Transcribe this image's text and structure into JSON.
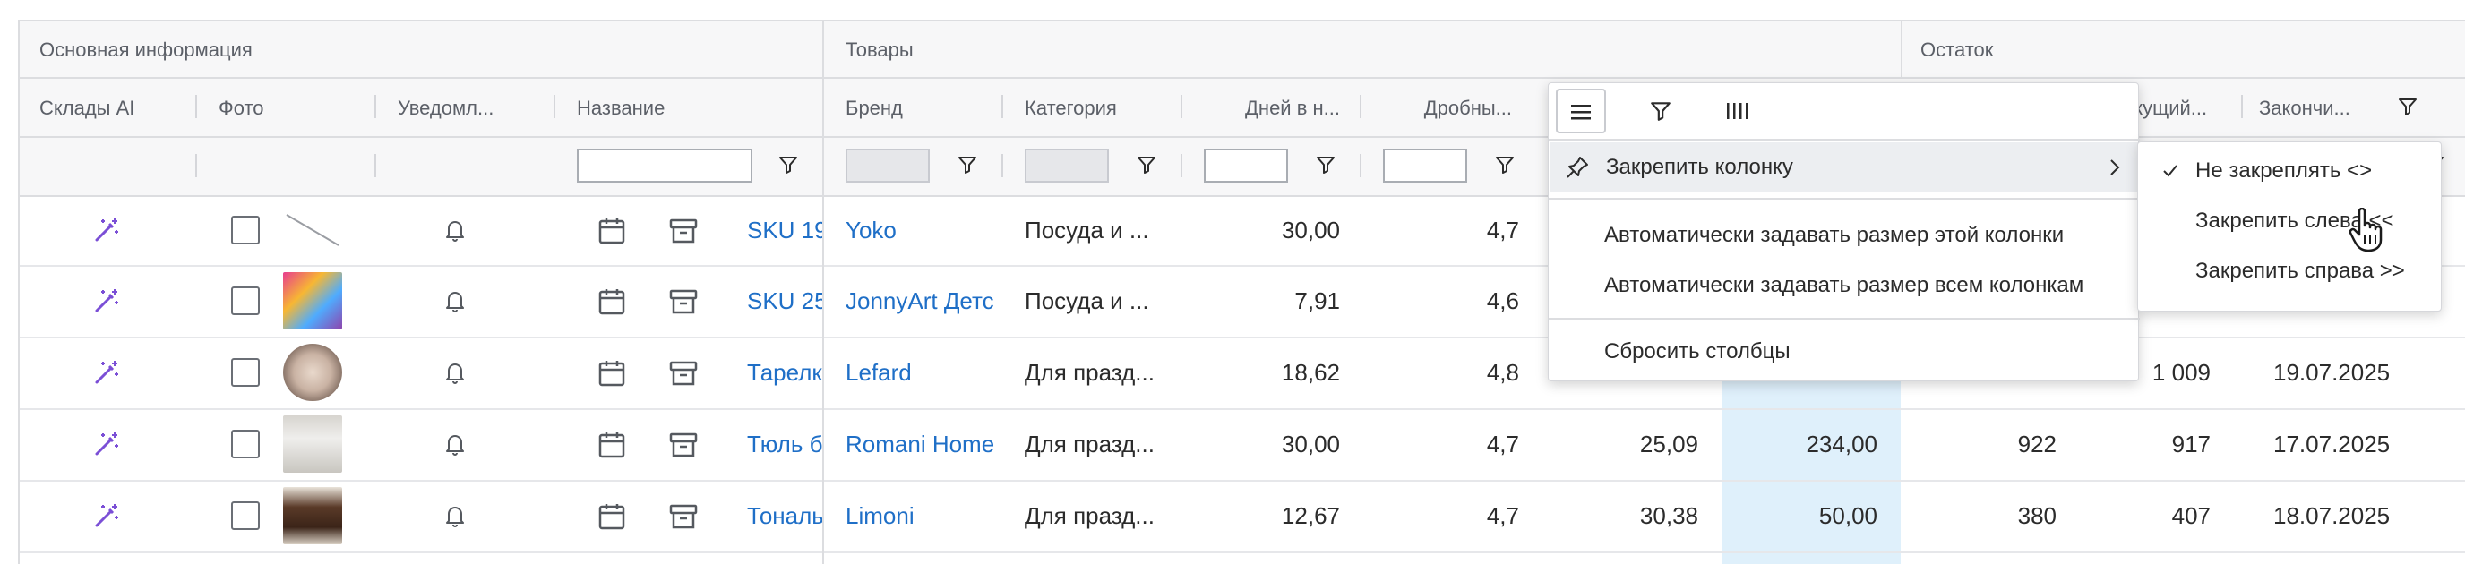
{
  "group_headers": {
    "main": "Основная информация",
    "goods": "Товары",
    "stock": "Остаток"
  },
  "columns": {
    "sklady": "Склады AI",
    "foto": "Фото",
    "uvedoml": "Уведомл...",
    "nazvanie": "Название",
    "brend": "Бренд",
    "kategoriya": "Категория",
    "dney": "Дней в н...",
    "drobny": "Дробны...",
    "tekushchiy": "екущий...",
    "zakonchi": "Закончи..."
  },
  "rows": [
    {
      "name": "SKU 19",
      "brand": "Yoko",
      "category": "Посуда и ...",
      "days": "30,00",
      "frac": "4,7",
      "c9": "",
      "c10": "",
      "tek": "",
      "end": ""
    },
    {
      "name": "SKU 25",
      "brand": "JonnyArt Детс",
      "category": "Посуда и ...",
      "days": "7,91",
      "frac": "4,6",
      "c9": "",
      "c10": "",
      "tek": "",
      "end": ""
    },
    {
      "name": "Тарелк",
      "brand": "Lefard",
      "category": "Для празд...",
      "days": "18,62",
      "frac": "4,8",
      "c9": "",
      "c10": "",
      "tek": "1 009",
      "end": "19.07.2025"
    },
    {
      "name": "Тюль б",
      "brand": "Romani Home",
      "category": "Для празд...",
      "days": "30,00",
      "frac": "4,7",
      "c9": "25,09",
      "c10": "234,00",
      "c11": "922",
      "tek": "917",
      "end": "17.07.2025"
    },
    {
      "name": "Тональ",
      "brand": "Limoni",
      "category": "Для празд...",
      "days": "12,67",
      "frac": "4,7",
      "c9": "30,38",
      "c10": "50,00",
      "c11": "380",
      "tek": "407",
      "end": "18.07.2025"
    }
  ],
  "column_menu": {
    "pin_column": "Закрепить колонку",
    "autosize_this": "Автоматически задавать размер этой колонки",
    "autosize_all": "Автоматически задавать размер всем колонкам",
    "reset_columns": "Сбросить столбцы"
  },
  "pin_submenu": {
    "no_pin": "Не закреплять <>",
    "pin_left": "Закрепить слева <<",
    "pin_right": "Закрепить справа >>"
  },
  "icons": {
    "ai": "magic-wand-icon",
    "notify": "bell-icon",
    "calendar": "calendar-icon",
    "archive": "archive-icon",
    "filter": "filter-icon",
    "menu": "hamburger-menu-icon",
    "columns": "columns-icon",
    "pin": "pin-icon",
    "check": "check-icon",
    "cursor": "hand-cursor-icon",
    "submenu_arrow": "chevron-right-icon"
  },
  "colors": {
    "link": "#1f6fc7",
    "ai_icon": "#7b4fd6",
    "highlight_column": "#dff0fb"
  }
}
